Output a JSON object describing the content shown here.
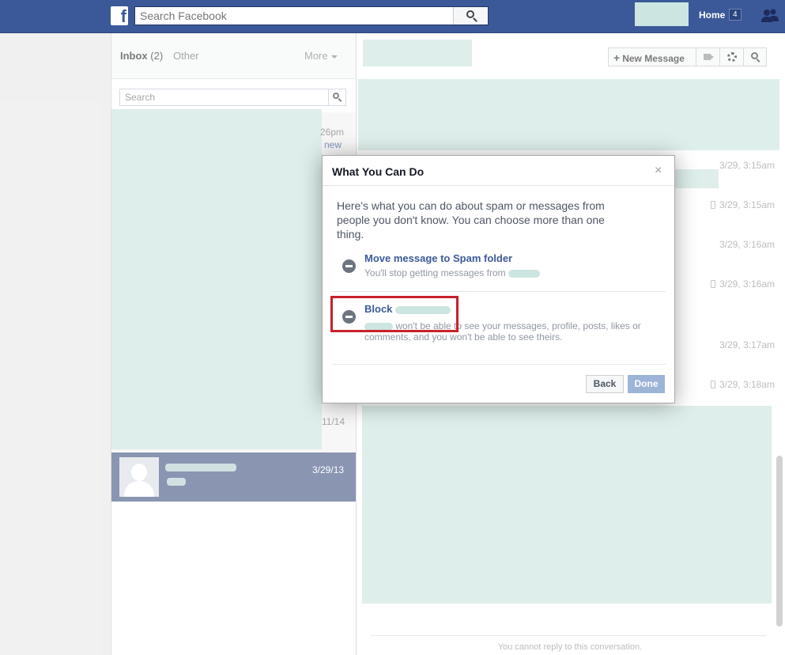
{
  "topbar": {
    "logo": "f",
    "search_placeholder": "Search Facebook",
    "home_label": "Home",
    "home_count": "4"
  },
  "inbox": {
    "inbox_label": "Inbox",
    "inbox_count": "(2)",
    "other_label": "Other",
    "more_label": "More",
    "search_placeholder": "Search",
    "snippets": [
      "26pm",
      "new",
      "11/14"
    ],
    "active_thread_date": "3/29/13"
  },
  "conversation": {
    "new_message_label": "New Message",
    "timestamps": [
      {
        "text": "3/29, 3:15am",
        "mobile": false
      },
      {
        "text": "3/29, 3:15am",
        "mobile": true
      },
      {
        "text": "3/29, 3:16am",
        "mobile": false
      },
      {
        "text": "3/29, 3:16am",
        "mobile": true
      },
      {
        "text": "3/29, 3:17am",
        "mobile": false
      },
      {
        "text": "3/29, 3:18am",
        "mobile": true
      }
    ],
    "reply_note": "You cannot reply to this conversation."
  },
  "dialog": {
    "title": "What You Can Do",
    "close": "×",
    "intro": "Here's what you can do about spam or messages from people you don't know. You can choose more than one thing.",
    "option1_title": "Move message to Spam folder",
    "option1_desc": "You'll stop getting messages from",
    "option2_title": "Block",
    "option2_desc": "won't be able to see your messages, profile, posts, likes or comments, and you won't be able to see theirs.",
    "back_label": "Back",
    "done_label": "Done"
  },
  "colors": {
    "brand": "#3b5998",
    "redaction": "#cde5e0",
    "highlight": "#c9202b"
  }
}
